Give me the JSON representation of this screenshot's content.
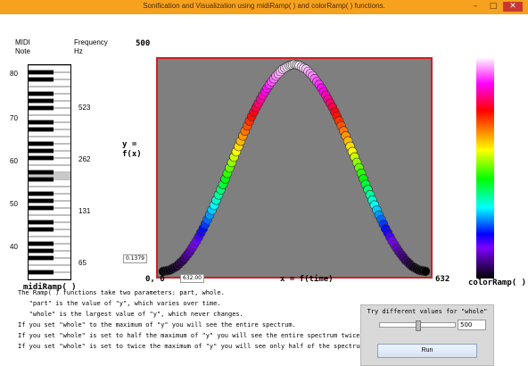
{
  "window": {
    "title": "Sonification and Visualization using midiRamp( ) and colorRamp( ) functions.",
    "minimize": "–",
    "maximize": "□",
    "close": "✕"
  },
  "piano": {
    "midi_label": "MIDI\nNote",
    "freq_label": "Frequency\nHz",
    "midi_ticks": [
      "80",
      "70",
      "60",
      "50",
      "40"
    ],
    "freq_ticks": [
      "523",
      "262",
      "131",
      "65"
    ],
    "name": "midiRamp( )"
  },
  "plot": {
    "y_top": "500",
    "ylabel": "y =\nf(x)",
    "origin": "0, 0",
    "x_max": "632",
    "xlabel": "x = f(time)",
    "readout_y": "0.1379",
    "readout_x": "632.00",
    "colorbar_label": "colorRamp( )"
  },
  "chart_data": {
    "type": "scatter",
    "title": "",
    "xlabel": "x = f(time)",
    "ylabel": "y = f(x)",
    "xlim": [
      0,
      632
    ],
    "ylim": [
      0,
      500
    ],
    "x": [
      0,
      16,
      32,
      48,
      64,
      80,
      96,
      112,
      128,
      144,
      160,
      176,
      192,
      208,
      224,
      240,
      256,
      272,
      288,
      304,
      316,
      328,
      344,
      360,
      376,
      392,
      408,
      424,
      440,
      456,
      472,
      488,
      504,
      520,
      536,
      552,
      568,
      584,
      600,
      616,
      632
    ],
    "y": [
      0,
      3,
      12,
      27,
      48,
      73,
      103,
      136,
      172,
      210,
      250,
      289,
      327,
      363,
      396,
      425,
      451,
      472,
      488,
      497,
      500,
      497,
      488,
      472,
      451,
      425,
      396,
      363,
      327,
      289,
      250,
      210,
      172,
      136,
      103,
      73,
      48,
      27,
      12,
      3,
      0
    ]
  },
  "description": {
    "line1": "The Ramp( ) functions take two parameters: part, whole.",
    "line2": "   \"part\" is the value of \"y\", which varies over time.",
    "line3": "   \"whole\" is the largest value of \"y\", which never changes.",
    "line4": "If you set \"whole\" to the maximum of \"y\" you will see the entire spectrum.",
    "line5": "If you set \"whole\" is set to half the maximum of \"y\" you will see the entire spectrum twice.",
    "line6": "If you set \"whole\" is set to twice the maximum of \"y\" you will see only half of the spectrum"
  },
  "controls": {
    "prompt": "Try different values for \"whole\"",
    "whole_value": "500",
    "slider_value": 0.5,
    "run_label": "Run"
  }
}
